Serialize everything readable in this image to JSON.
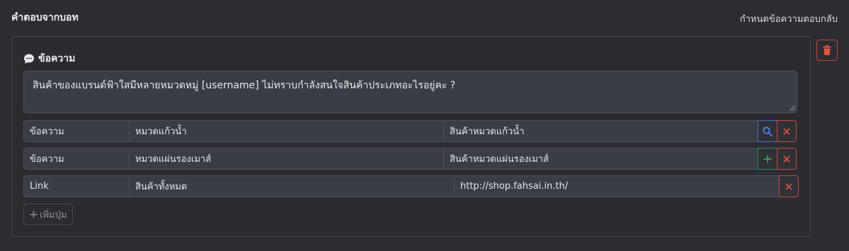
{
  "header": {
    "title": "คำตอบจากบอท",
    "link": "กำหนดข้อความตอบกลับ"
  },
  "card": {
    "title": "ข้อความ",
    "title_icon": "chat-bubble-icon",
    "message": "สินค้าของแบรนด์ฟ้าใสมีหลายหมวดหมู่ [username] ไม่ทราบกำลังสนใจสินค้าประเภทอะไรอยู่คะ ?",
    "buttons": [
      {
        "type": "ข้อความ",
        "label": "หมวดแก้วน้ำ",
        "value": "สินค้าหมวดแก้วน้ำ",
        "action_icon": "search-icon"
      },
      {
        "type": "ข้อความ",
        "label": "หมวดแผ่นรองเมาส์",
        "value": "สินค้าหมวดแผ่นรองเมาส์",
        "action_icon": "plus-icon"
      },
      {
        "type": "Link",
        "label": "สินค้าทั้งหมด",
        "value": "http://shop.fahsai.in.th/"
      }
    ],
    "add_button_label": "เพิ่มปุ่ม"
  },
  "colors": {
    "background": "#2b2d33",
    "input": "#3a3d45",
    "danger": "#c8473a",
    "primary": "#3b6fd1",
    "success": "#2e8a4a"
  }
}
